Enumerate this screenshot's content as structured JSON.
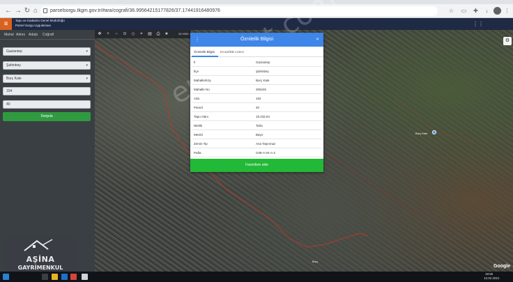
{
  "browser": {
    "url": "parselsorgu.tkgm.gov.tr/#ara/cografi/36.99564215177826/37.17441916480976",
    "icons": [
      "back-arrow-icon",
      "forward-arrow-icon",
      "reload-icon",
      "home-icon",
      "star-icon",
      "extensions-icon"
    ]
  },
  "header": {
    "org": "Tapu ve Kadastro Genel Müdürlüğü",
    "app": "Parsel Sorgu Uygulaması",
    "right": "⋮⋮"
  },
  "search": {
    "tabs": [
      "Mahal",
      "Adres",
      "Ada/p",
      "Coğrafi"
    ],
    "fields": [
      "Gaziantep",
      "Şahinbey",
      "Burç Kale",
      "154",
      "40"
    ],
    "button": "Sorgula"
  },
  "map": {
    "readout": "36.9956 - 37.1744",
    "google": "Google",
    "places": [
      "Burç Kale",
      "Burç"
    ]
  },
  "popup": {
    "title": "Öznitelik Bilgisi",
    "tabs": [
      "Öznitelik Bilgisi",
      "Emsal/BB Listesi"
    ],
    "rows": [
      {
        "key": "İl",
        "value": "Gaziantep"
      },
      {
        "key": "İlçe",
        "value": "Şahinbey"
      },
      {
        "key": "Mahalle/Köy",
        "value": "Burç Kale"
      },
      {
        "key": "Mahalle No",
        "value": "206245"
      },
      {
        "key": "Ada",
        "value": "154"
      },
      {
        "key": "Parsel",
        "value": "40"
      },
      {
        "key": "Tapu Alanı",
        "value": "18.232,64"
      },
      {
        "key": "Nitelik",
        "value": "Tarla"
      },
      {
        "key": "Mevkii",
        "value": "Bayır"
      },
      {
        "key": "Zemin Tip",
        "value": "Ana Taşınmaz"
      },
      {
        "key": "Pafta",
        "value": "O38-A-04-A-2"
      }
    ],
    "favorite_label": "Favorilere ekle"
  },
  "watermark": "emlakjet.com",
  "brand": {
    "name": "AŞİNA",
    "sub": "GAYRİMENKUL"
  },
  "taskbar": {
    "time": "18:55",
    "date": "13.02.2021"
  }
}
